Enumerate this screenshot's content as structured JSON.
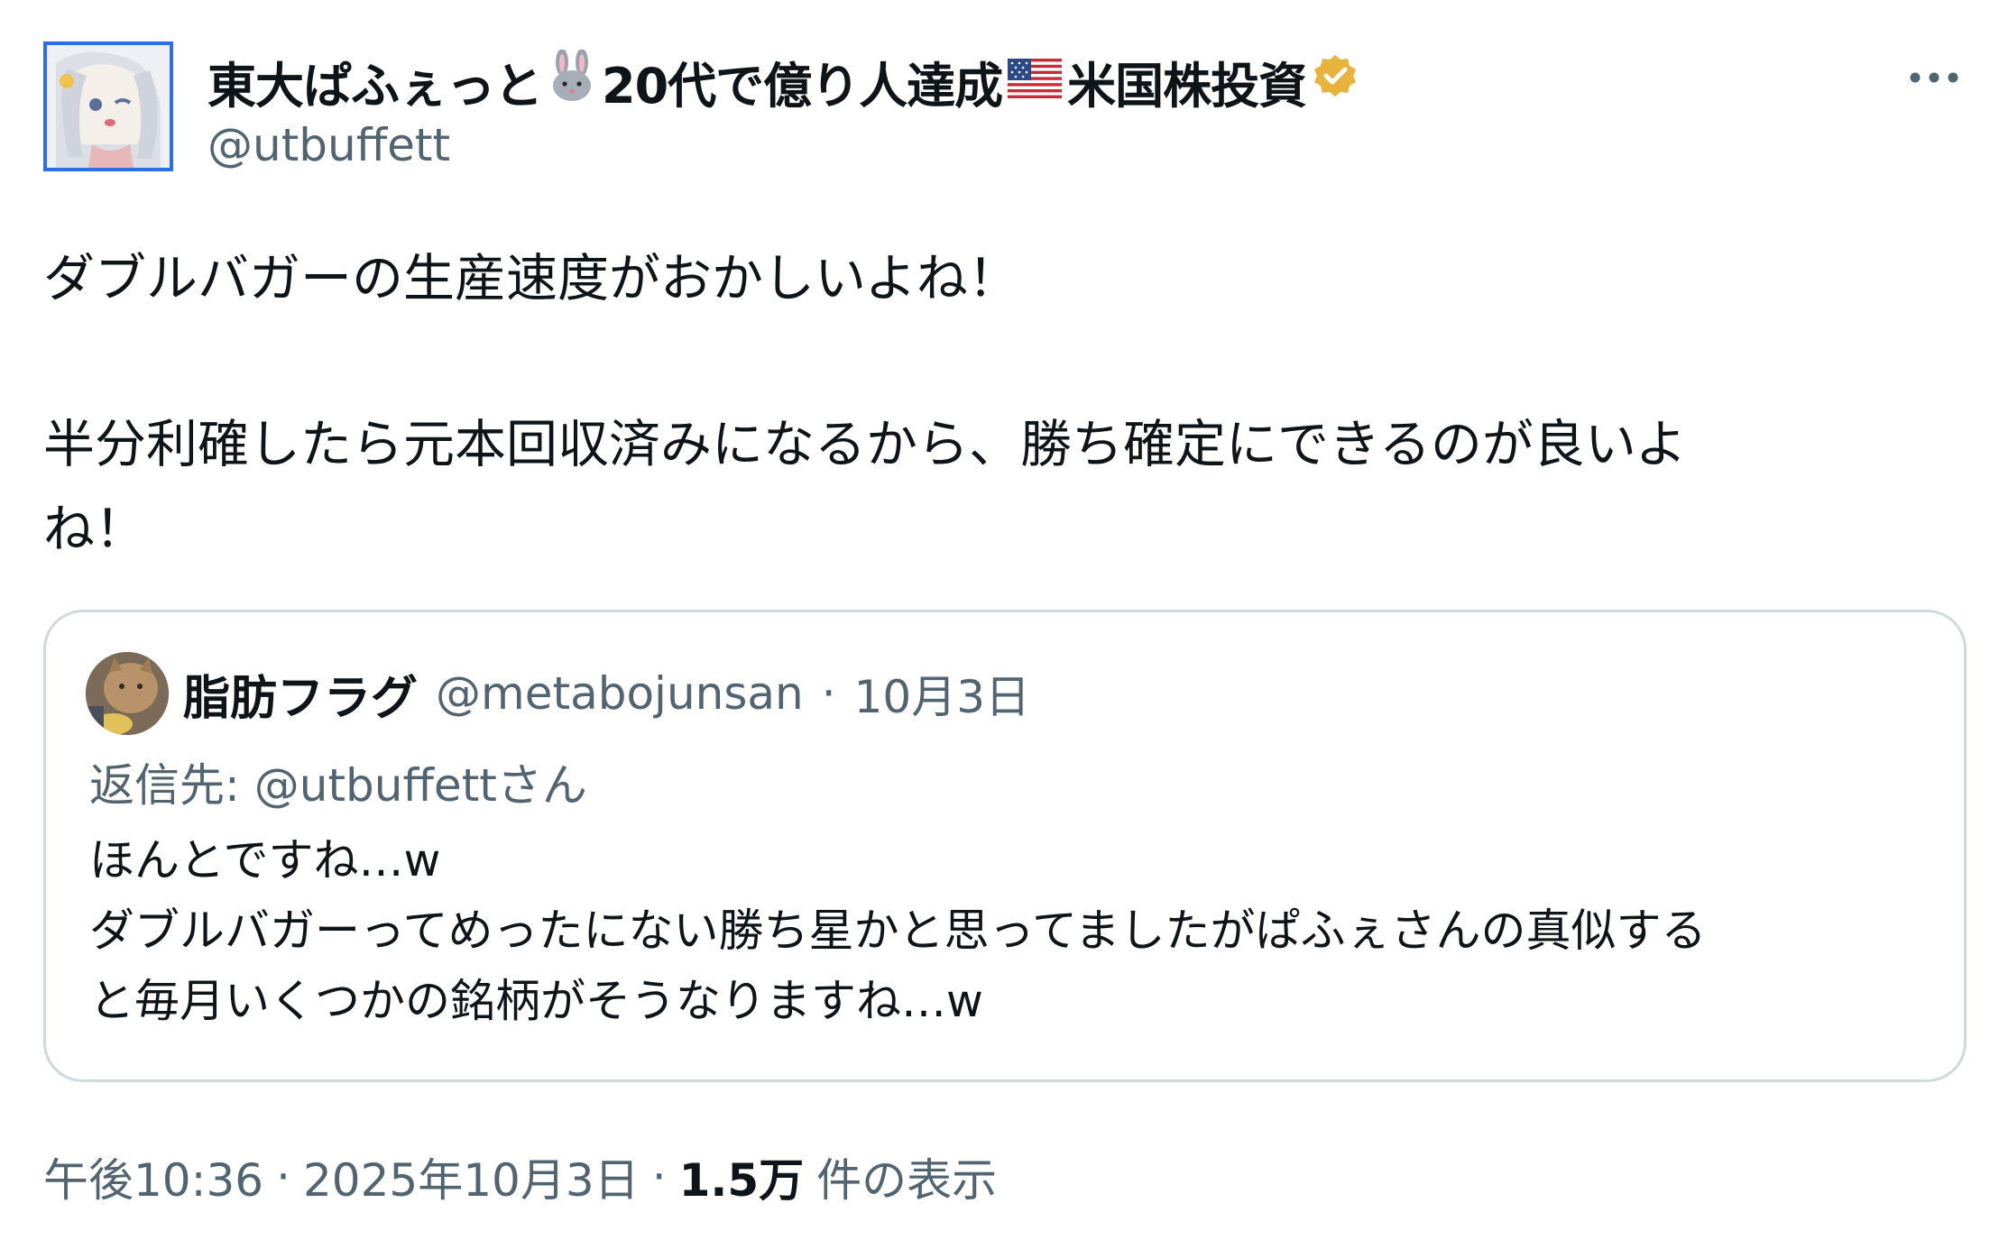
{
  "tweet": {
    "author": {
      "name_part1": "東大ぱふぇっと",
      "name_part2": "20代で億り人達成",
      "name_part3": "米国株投資",
      "rabbit_icon": "rabbit-emoji-icon",
      "flag_icon": "us-flag-icon",
      "verified_icon": "verified-badge-icon",
      "handle": "@utbuffett"
    },
    "text_lines": [
      "ダブルバガーの生産速度がおかしいよね！",
      "半分利確したら元本回収済みになるから、勝ち確定にできるのが良いよ",
      "ね！"
    ],
    "quoted": {
      "name": "脂肪フラグ",
      "handle": "@metabojunsan",
      "separator": "·",
      "date": "10月3日",
      "reply_prefix": "返信先:",
      "reply_mention": "@utbuffettさん",
      "text_lines": [
        "ほんとですね…w",
        "ダブルバガーってめったにない勝ち星かと思ってましたがぱふぇさんの真似する",
        "と毎月いくつかの銘柄がそうなりますね…w"
      ]
    },
    "meta": {
      "time": "午後10:36",
      "sep1": "·",
      "date": "2025年10月3日",
      "sep2": "·",
      "views_count": "1.5万",
      "views_label": "件の表示"
    }
  },
  "colors": {
    "text_primary": "#0f1419",
    "text_secondary": "#536471",
    "border": "#cfd9de",
    "verified_gold": "#e8b33a",
    "avatar_border": "#2b6ee8"
  },
  "icons": {
    "more": "more-horizontal-icon"
  }
}
